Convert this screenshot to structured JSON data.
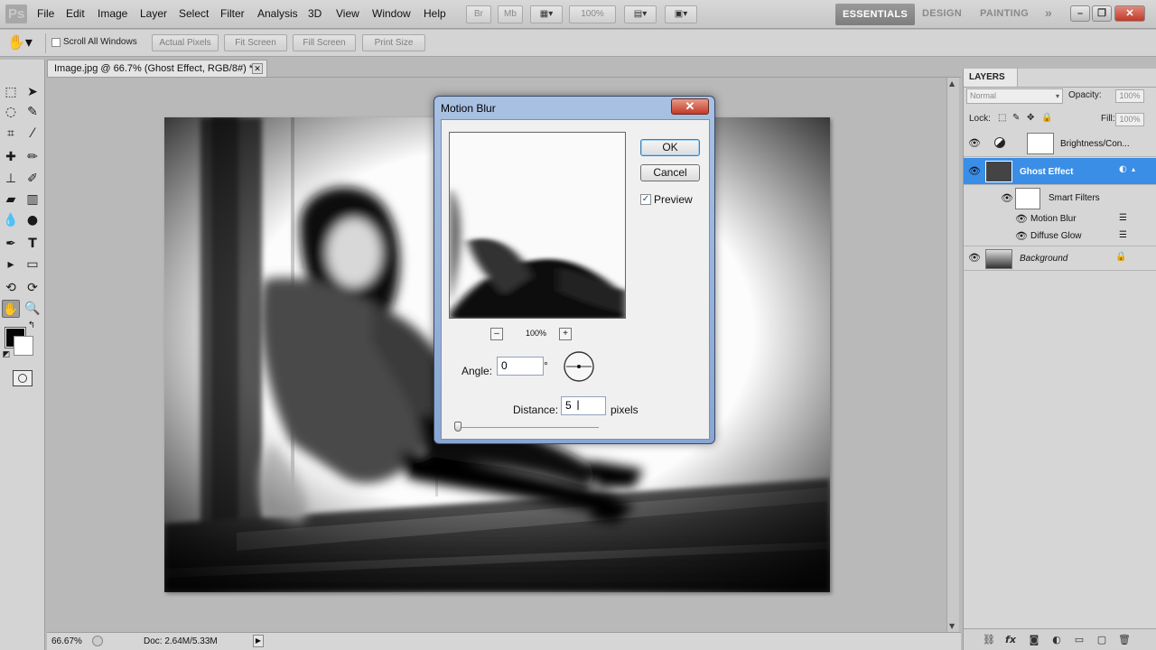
{
  "app": {
    "logo": "Ps",
    "menu": [
      "File",
      "Edit",
      "Image",
      "Layer",
      "Select",
      "Filter",
      "Analysis",
      "3D",
      "View",
      "Window",
      "Help"
    ],
    "menubar_buttons": {
      "br": "Br",
      "mb": "Mb",
      "zoom": "100%"
    },
    "workspaces": [
      "ESSENTIALS",
      "DESIGN",
      "PAINTING"
    ],
    "workspace_more": "»",
    "window_controls": {
      "minimize": "–",
      "restore": "❐",
      "close": "✕"
    }
  },
  "options_bar": {
    "scroll_all_windows": "Scroll All Windows",
    "buttons": [
      "Actual Pixels",
      "Fit Screen",
      "Fill Screen",
      "Print Size"
    ]
  },
  "document": {
    "tab_title": "Image.jpg @ 66.7% (Ghost Effect, RGB/8#) *",
    "close": "✕",
    "zoom": "66.67%",
    "doc_info": "Doc: 2.64M/5.33M"
  },
  "layers_panel": {
    "title": "LAYERS",
    "blend_mode": "Normal",
    "opacity_label": "Opacity:",
    "opacity": "100%",
    "lock_label": "Lock:",
    "fill_label": "Fill:",
    "fill": "100%",
    "layers": [
      {
        "name": "Brightness/Con...",
        "type": "adjustment"
      },
      {
        "name": "Ghost Effect",
        "type": "smart-object",
        "selected": true
      },
      {
        "name": "Smart Filters",
        "type": "filter-mask"
      },
      {
        "name": "Motion Blur",
        "type": "filter"
      },
      {
        "name": "Diffuse Glow",
        "type": "filter"
      },
      {
        "name": "Background",
        "type": "background",
        "locked": true
      }
    ]
  },
  "dialog": {
    "title": "Motion Blur",
    "close": "✕",
    "ok": "OK",
    "cancel": "Cancel",
    "preview_label": "Preview",
    "preview_checked": true,
    "zoom_level": "100%",
    "zoom_out": "–",
    "zoom_in": "+",
    "angle_label": "Angle:",
    "angle_value": "0",
    "angle_unit": "°",
    "distance_label": "Distance:",
    "distance_value": "5",
    "distance_unit": "pixels",
    "distance_slider_fraction": 0.0
  },
  "colors": {
    "selection": "#3a8ee6",
    "foreground": "#050505",
    "background": "#ffffff",
    "dialog_frame": "#88a6d3"
  }
}
